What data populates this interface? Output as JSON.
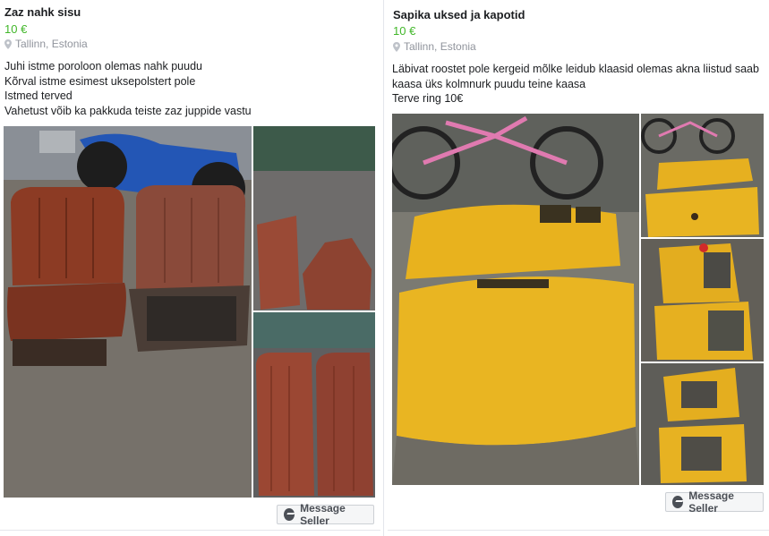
{
  "listings": [
    {
      "title": "Zaz nahk sisu",
      "price": "10 €",
      "location": "Tallinn, Estonia",
      "description": "Juhi istme poroloon olemas nahk puudu\nKõrval istme esimest uksepolstert pole\nIstmed terved\nVahetust võib ka pakkuda teiste zaz juppide vastu",
      "button_label": "Message Seller",
      "icons": {
        "location": "map-pin-icon",
        "message": "messenger-icon"
      }
    },
    {
      "title": "Sapika uksed ja kapotid",
      "price": "10 €",
      "location": "Tallinn, Estonia",
      "description": "Läbivat roostet pole kergeid mõlke leidub klaasid olemas akna liistud saab kaasa üks kolmnurk puudu teine kaasa\nTerve ring 10€",
      "button_label": "Message Seller",
      "icons": {
        "location": "map-pin-icon",
        "message": "messenger-icon"
      }
    }
  ],
  "colors": {
    "price": "#42b72a",
    "muted": "#90949c",
    "text": "#1c1e21"
  }
}
